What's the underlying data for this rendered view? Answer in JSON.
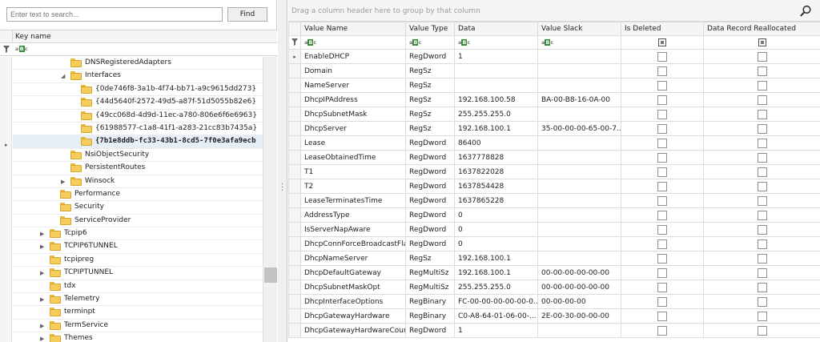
{
  "search": {
    "placeholder": "Enter text to search...",
    "find_label": "Find"
  },
  "tree": {
    "column_header": "Key name",
    "rows": [
      {
        "label": "DNSRegisteredAdapters",
        "level": 5,
        "twisty": "",
        "selected": false
      },
      {
        "label": "Interfaces",
        "level": 5,
        "twisty": "expanded",
        "selected": false
      },
      {
        "label": "{0de746f8-3a1b-4f74-bb71-a9c9615dd273}",
        "level": 6,
        "twisty": "",
        "selected": false
      },
      {
        "label": "{44d5640f-2572-49d5-a87f-51d5055b82e6}",
        "level": 6,
        "twisty": "",
        "selected": false
      },
      {
        "label": "{49cc068d-4d9d-11ec-a780-806e6f6e6963}",
        "level": 6,
        "twisty": "",
        "selected": false
      },
      {
        "label": "{61988577-c1a8-41f1-a283-21cc83b7435a}",
        "level": 6,
        "twisty": "",
        "selected": false
      },
      {
        "label": "{7b1e8ddb-fc33-43b1-8cd5-7f0e3afa9ecb",
        "level": 6,
        "twisty": "",
        "selected": true
      },
      {
        "label": "NsiObjectSecurity",
        "level": 5,
        "twisty": "",
        "selected": false
      },
      {
        "label": "PersistentRoutes",
        "level": 5,
        "twisty": "",
        "selected": false
      },
      {
        "label": "Winsock",
        "level": 5,
        "twisty": "collapsed",
        "selected": false
      },
      {
        "label": "Performance",
        "level": 4,
        "twisty": "",
        "selected": false
      },
      {
        "label": "Security",
        "level": 4,
        "twisty": "",
        "selected": false
      },
      {
        "label": "ServiceProvider",
        "level": 4,
        "twisty": "",
        "selected": false
      },
      {
        "label": "Tcpip6",
        "level": 3,
        "twisty": "collapsed",
        "selected": false
      },
      {
        "label": "TCPIP6TUNNEL",
        "level": 3,
        "twisty": "collapsed",
        "selected": false
      },
      {
        "label": "tcpipreg",
        "level": 3,
        "twisty": "",
        "selected": false
      },
      {
        "label": "TCPIPTUNNEL",
        "level": 3,
        "twisty": "collapsed",
        "selected": false
      },
      {
        "label": "tdx",
        "level": 3,
        "twisty": "",
        "selected": false
      },
      {
        "label": "Telemetry",
        "level": 3,
        "twisty": "collapsed",
        "selected": false
      },
      {
        "label": "terminpt",
        "level": 3,
        "twisty": "",
        "selected": false
      },
      {
        "label": "TermService",
        "level": 3,
        "twisty": "collapsed",
        "selected": false
      },
      {
        "label": "Themes",
        "level": 3,
        "twisty": "collapsed",
        "selected": false
      }
    ]
  },
  "grid": {
    "group_hint": "Drag a column header here to group by that column",
    "columns": [
      "Value Name",
      "Value Type",
      "Data",
      "Value Slack",
      "Is Deleted",
      "Data Record Reallocated"
    ],
    "rows": [
      {
        "name": "EnableDHCP",
        "type": "RegDword",
        "data": "1",
        "slack": "",
        "current": true
      },
      {
        "name": "Domain",
        "type": "RegSz",
        "data": "",
        "slack": ""
      },
      {
        "name": "NameServer",
        "type": "RegSz",
        "data": "",
        "slack": ""
      },
      {
        "name": "DhcpIPAddress",
        "type": "RegSz",
        "data": "192.168.100.58",
        "slack": "BA-00-B8-16-0A-00"
      },
      {
        "name": "DhcpSubnetMask",
        "type": "RegSz",
        "data": "255.255.255.0",
        "slack": ""
      },
      {
        "name": "DhcpServer",
        "type": "RegSz",
        "data": "192.168.100.1",
        "slack": "35-00-00-00-65-00-7..."
      },
      {
        "name": "Lease",
        "type": "RegDword",
        "data": "86400",
        "slack": ""
      },
      {
        "name": "LeaseObtainedTime",
        "type": "RegDword",
        "data": "1637778828",
        "slack": ""
      },
      {
        "name": "T1",
        "type": "RegDword",
        "data": "1637822028",
        "slack": ""
      },
      {
        "name": "T2",
        "type": "RegDword",
        "data": "1637854428",
        "slack": ""
      },
      {
        "name": "LeaseTerminatesTime",
        "type": "RegDword",
        "data": "1637865228",
        "slack": ""
      },
      {
        "name": "AddressType",
        "type": "RegDword",
        "data": "0",
        "slack": ""
      },
      {
        "name": "IsServerNapAware",
        "type": "RegDword",
        "data": "0",
        "slack": ""
      },
      {
        "name": "DhcpConnForceBroadcastFlag",
        "type": "RegDword",
        "data": "0",
        "slack": ""
      },
      {
        "name": "DhcpNameServer",
        "type": "RegSz",
        "data": "192.168.100.1",
        "slack": ""
      },
      {
        "name": "DhcpDefaultGateway",
        "type": "RegMultiSz",
        "data": "192.168.100.1",
        "slack": "00-00-00-00-00-00"
      },
      {
        "name": "DhcpSubnetMaskOpt",
        "type": "RegMultiSz",
        "data": "255.255.255.0",
        "slack": "00-00-00-00-00-00"
      },
      {
        "name": "DhcpInterfaceOptions",
        "type": "RegBinary",
        "data": "FC-00-00-00-00-00-0...",
        "slack": "00-00-00-00"
      },
      {
        "name": "DhcpGatewayHardware",
        "type": "RegBinary",
        "data": "C0-A8-64-01-06-00-...",
        "slack": "2E-00-30-00-00-00"
      },
      {
        "name": "DhcpGatewayHardwareCount",
        "type": "RegDword",
        "data": "1",
        "slack": ""
      }
    ]
  },
  "icons": {
    "folder": "folder-icon",
    "search": "magnifier-icon",
    "filter": "funnel-icon",
    "text_filter": "abc-filter-icon",
    "expanded": "triangle-down-icon",
    "collapsed": "triangle-right-icon"
  },
  "colors": {
    "selection": "#e6eef8",
    "folder": "#f4cd5c",
    "abc_accent": "#3a8a3a"
  }
}
